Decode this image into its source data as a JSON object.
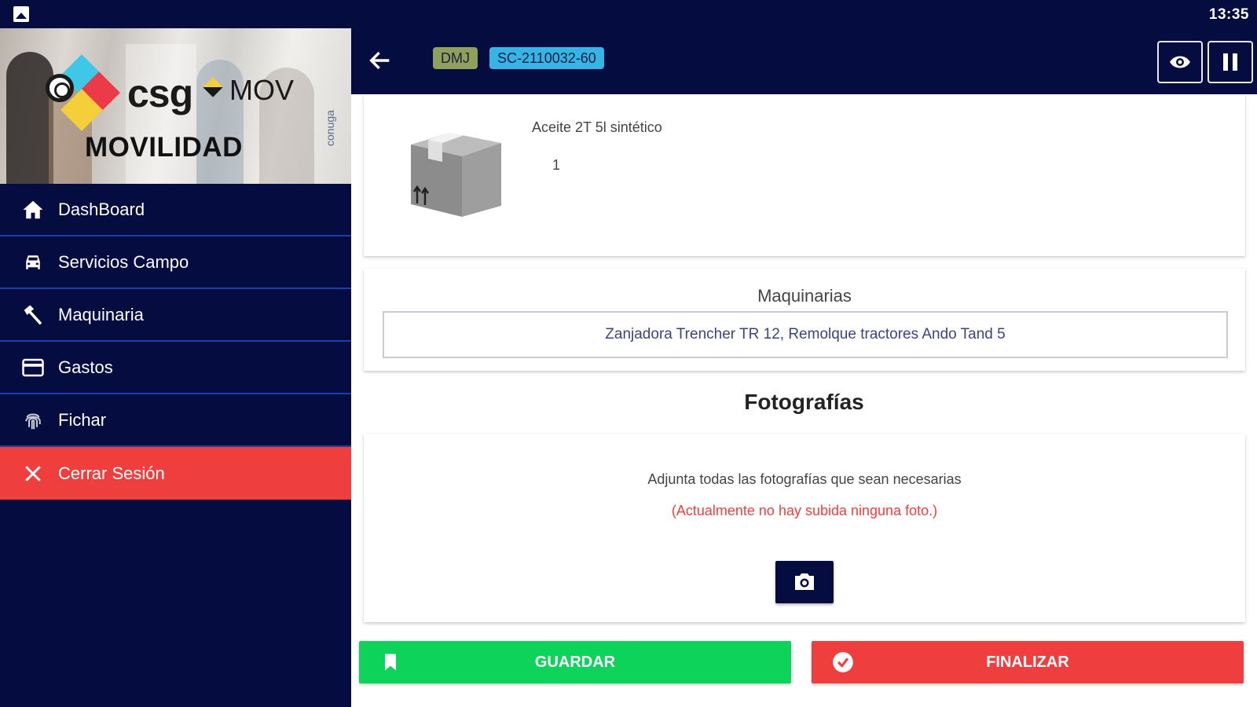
{
  "statusbar": {
    "time": "13:35",
    "left_icon": "gallery-icon"
  },
  "brand": {
    "logo_text": "csg",
    "product": "MOV",
    "subtitle": "MOVILIDAD",
    "side_text": "conuga"
  },
  "sidebar": {
    "items": [
      {
        "label": "DashBoard",
        "icon": "home-icon"
      },
      {
        "label": "Servicios Campo",
        "icon": "car-icon"
      },
      {
        "label": "Maquinaria",
        "icon": "hammer-icon"
      },
      {
        "label": "Gastos",
        "icon": "credit-card-icon"
      },
      {
        "label": "Fichar",
        "icon": "fingerprint-icon"
      },
      {
        "label": "Cerrar Sesión",
        "icon": "close-icon",
        "color": "#ef3e3e"
      }
    ]
  },
  "header": {
    "tags": [
      {
        "label": "DMJ",
        "color": "#8fa05d"
      },
      {
        "label": "SC-2110032-60",
        "color": "#37b4e6"
      }
    ],
    "buttons": [
      "eye-icon",
      "pause-icon"
    ]
  },
  "product": {
    "name": "Aceite 2T 5l sintético",
    "quantity": "1",
    "icon": "box-icon"
  },
  "machinery": {
    "title": "Maquinarias",
    "value": "Zanjadora Trencher TR 12, Remolque tractores Ando Tand 5"
  },
  "photos": {
    "title": "Fotografías",
    "description": "Adjunta todas las fotografías que sean necesarias",
    "empty_message": "(Actualmente no hay subida ninguna foto.)",
    "camera_icon": "camera-icon"
  },
  "actions": {
    "save_label": "GUARDAR",
    "finish_label": "FINALIZAR",
    "save_color": "#0dd35a",
    "finish_color": "#ef3e3e"
  },
  "colors": {
    "navy": "#050c3f",
    "divider": "#1d3ea8"
  }
}
